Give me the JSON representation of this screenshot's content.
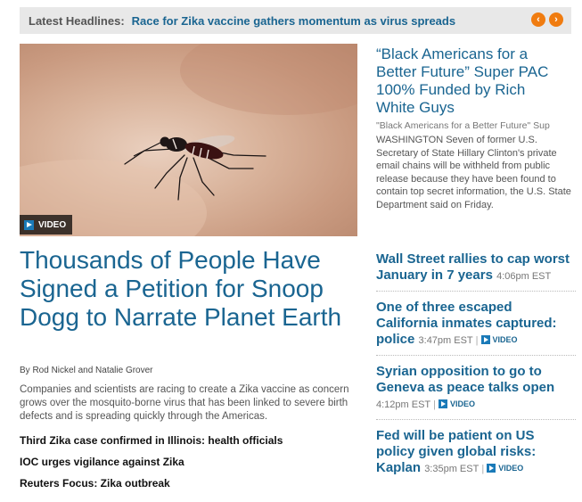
{
  "ticker": {
    "label": "Latest Headlines:",
    "headline": "Race for Zika vaccine gathers momentum as virus spreads",
    "prev_icon": "chevron-left-icon",
    "next_icon": "chevron-right-icon",
    "prev_glyph": "‹",
    "next_glyph": "›",
    "accent": "#f07c10"
  },
  "hero": {
    "video_badge": "VIDEO"
  },
  "lead_story": {
    "headline": "Thousands of People Have Signed a Petition for Snoop Dogg to Narrate Planet Earth",
    "byline": "By Rod Nickel and Natalie Grover",
    "summary": "Companies and scientists are racing to create a Zika vaccine as concern grows over the mosquito-borne virus that has been linked to severe birth defects and is spreading quickly through the Americas.",
    "related": [
      "Third Zika case confirmed in Illinois: health officials",
      "IOC urges vigilance against Zika",
      "Reuters Focus: Zika outbreak"
    ]
  },
  "side_feature": {
    "headline": "“Black Americans for a Better Future” Super PAC 100% Funded by Rich White Guys",
    "subhead": "\"Black Americans for a Better Future\" Sup",
    "body": "WASHINGTON Seven of former U.S. Secretary of State Hillary Clinton's private email chains will be withheld from public release because they have been found to contain top secret information, the U.S. State Department said on Friday."
  },
  "side_stories": [
    {
      "headline": "Wall Street rallies to cap worst January in 7 years",
      "time": "4:06pm EST",
      "video": ""
    },
    {
      "headline": "One of three escaped California inmates captured: police",
      "time": "3:47pm EST",
      "video": "VIDEO"
    },
    {
      "headline": "Syrian opposition to go to Geneva as peace talks open",
      "time": "4:12pm EST",
      "video": "VIDEO"
    },
    {
      "headline": "Fed will be patient on US policy given global risks: Kaplan",
      "time": "3:35pm EST",
      "video": "VIDEO"
    }
  ],
  "colors": {
    "link_blue": "#1a6591",
    "ticker_bg": "#e8e8e8",
    "video_blue": "#1a7ab8"
  }
}
